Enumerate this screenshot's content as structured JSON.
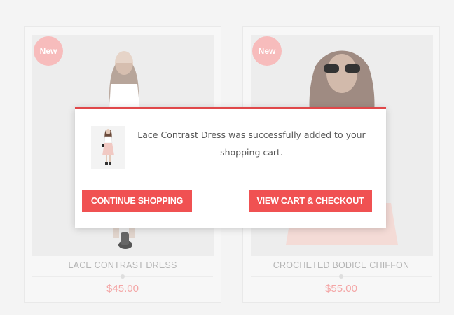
{
  "products": [
    {
      "badge": "New",
      "name": "LACE CONTRAST DRESS",
      "price": "$45.00"
    },
    {
      "badge": "New",
      "name": "CROCHETED BODICE CHIFFON",
      "price": "$55.00"
    }
  ],
  "modal": {
    "message": "Lace Contrast Dress was successfully added to your shopping cart.",
    "continue_label": "CONTINUE SHOPPING",
    "checkout_label": "VIEW CART & CHECKOUT",
    "accent_color": "#f05152"
  }
}
